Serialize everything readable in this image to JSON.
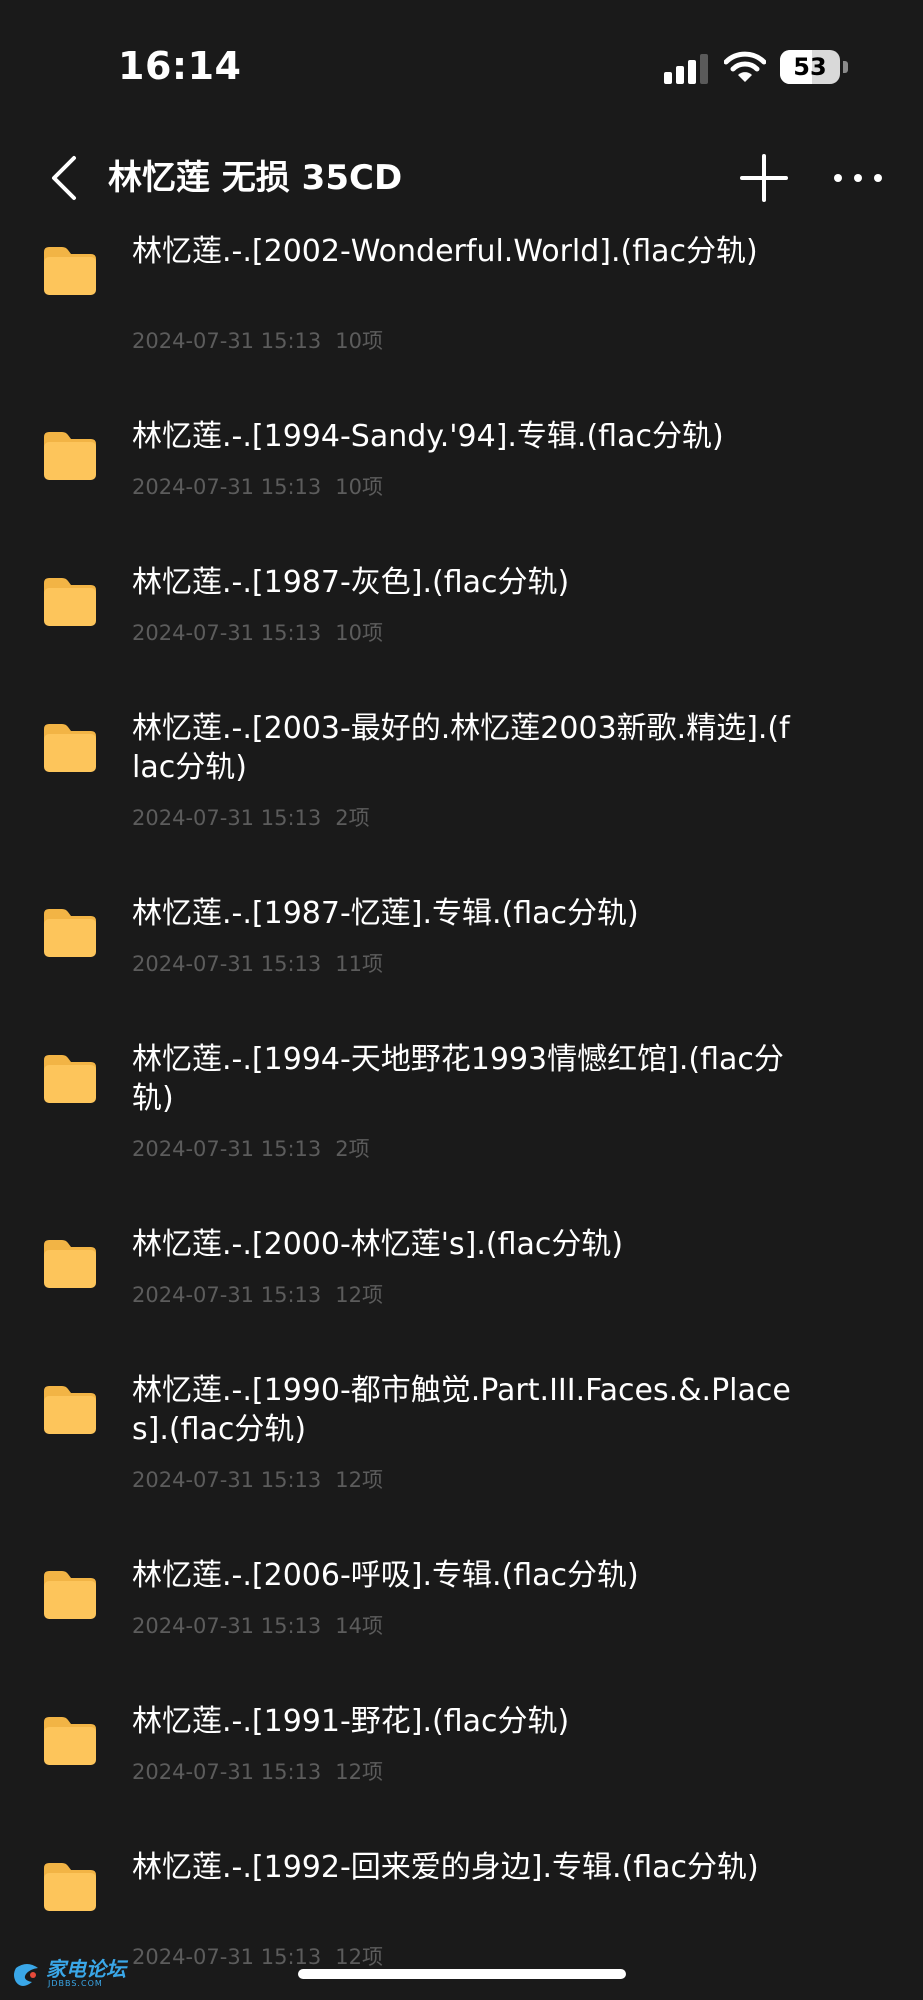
{
  "status_bar": {
    "time": "16:14",
    "battery_level": "53",
    "battery_fraction": 0.53
  },
  "nav": {
    "title": "林忆莲 无损 35CD"
  },
  "folders": [
    {
      "name": "林忆莲.-.[2002-Wonderful.World].(flac分轨)",
      "date": "2024-07-31 15:13",
      "count": "10项"
    },
    {
      "name": "林忆莲.-.[1994-Sandy.'94].专辑.(flac分轨)",
      "date": "2024-07-31 15:13",
      "count": "10项"
    },
    {
      "name": "林忆莲.-.[1987-灰色].(flac分轨)",
      "date": "2024-07-31 15:13",
      "count": "10项"
    },
    {
      "name": "林忆莲.-.[2003-最好的.林忆莲2003新歌.精选].(flac分轨)",
      "date": "2024-07-31 15:13",
      "count": "2项"
    },
    {
      "name": "林忆莲.-.[1987-忆莲].专辑.(flac分轨)",
      "date": "2024-07-31 15:13",
      "count": "11项"
    },
    {
      "name": "林忆莲.-.[1994-天地野花1993情憾红馆].(flac分轨)",
      "date": "2024-07-31 15:13",
      "count": "2项"
    },
    {
      "name": "林忆莲.-.[2000-林忆莲's].(flac分轨)",
      "date": "2024-07-31 15:13",
      "count": "12项"
    },
    {
      "name": "林忆莲.-.[1990-都市触觉.Part.III.Faces.&.Places].(flac分轨)",
      "date": "2024-07-31 15:13",
      "count": "12项"
    },
    {
      "name": "林忆莲.-.[2006-呼吸].专辑.(flac分轨)",
      "date": "2024-07-31 15:13",
      "count": "14项"
    },
    {
      "name": "林忆莲.-.[1991-野花].(flac分轨)",
      "date": "2024-07-31 15:13",
      "count": "12项"
    },
    {
      "name": "林忆莲.-.[1992-回来爱的身边].专辑.(flac分轨)",
      "date": "2024-07-31 15:13",
      "count": "12项"
    }
  ],
  "watermark": {
    "name": "家电论坛",
    "domain": "JDBBS.COM"
  },
  "colors": {
    "background": "#1a1a1a",
    "folder_icon": "#fdc55b",
    "folder_icon_tab": "#f2b445",
    "meta_text": "#5c5c5c",
    "watermark": "#3aa7e8"
  },
  "icons": {
    "back": "chevron-left-icon",
    "add": "plus-icon",
    "more": "ellipsis-icon",
    "folder": "folder-icon",
    "signal": "cellular-signal-icon",
    "wifi": "wifi-icon",
    "battery": "battery-icon"
  }
}
